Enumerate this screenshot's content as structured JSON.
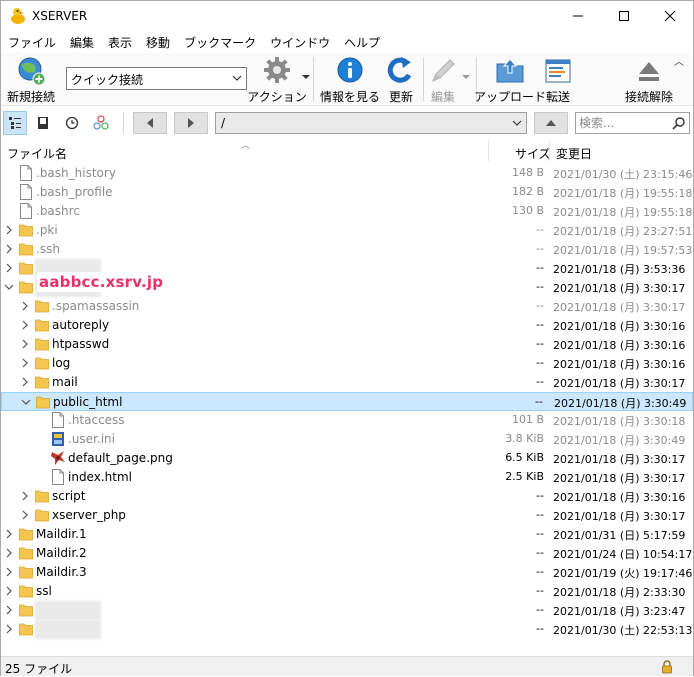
{
  "window": {
    "title": "XSERVER",
    "app_icon": "duck-icon",
    "controls": [
      "minimize-icon",
      "maximize-icon",
      "close-icon"
    ]
  },
  "menu": [
    "ファイル",
    "編集",
    "表示",
    "移動",
    "ブックマーク",
    "ウインドウ",
    "ヘルプ"
  ],
  "toolbar": {
    "new_connection": "新規接続",
    "quick_connect": "クイック接続",
    "action": "アクション",
    "info": "情報を見る",
    "refresh": "更新",
    "edit": "編集",
    "upload": "アップロード",
    "transfer": "転送",
    "disconnect": "接続解除"
  },
  "navbar": {
    "path": "/",
    "search_placeholder": "検索..."
  },
  "columns": {
    "name": "ファイル名",
    "size": "サイズ",
    "modified": "変更日"
  },
  "domain_label": "aabbcc.xsrv.jp",
  "files": [
    {
      "name": ".bash_history",
      "size": "148 B",
      "date": "2021/01/30 (土) 23:15:46",
      "type": "file",
      "depth": 0,
      "hidden": true
    },
    {
      "name": ".bash_profile",
      "size": "182 B",
      "date": "2021/01/18 (月) 19:55:18",
      "type": "file",
      "depth": 0,
      "hidden": true
    },
    {
      "name": ".bashrc",
      "size": "130 B",
      "date": "2021/01/18 (月) 19:55:18",
      "type": "file",
      "depth": 0,
      "hidden": true
    },
    {
      "name": ".pki",
      "size": "--",
      "date": "2021/01/18 (月) 23:27:51",
      "type": "folder",
      "depth": 0,
      "hidden": true,
      "expander": "collapsed"
    },
    {
      "name": ".ssh",
      "size": "--",
      "date": "2021/01/18 (月) 19:57:53",
      "type": "folder",
      "depth": 0,
      "hidden": true,
      "expander": "collapsed"
    },
    {
      "name": "",
      "size": "--",
      "date": "2021/01/18 (月) 3:53:36",
      "type": "folder",
      "depth": 0,
      "expander": "collapsed",
      "redacted": true
    },
    {
      "name": "",
      "size": "--",
      "date": "2021/01/18 (月) 3:30:17",
      "type": "folder",
      "depth": 0,
      "expander": "expanded",
      "redacted": true
    },
    {
      "name": ".spamassassin",
      "size": "--",
      "date": "2021/01/18 (月) 3:30:17",
      "type": "folder",
      "depth": 1,
      "hidden": true,
      "expander": "collapsed"
    },
    {
      "name": "autoreply",
      "size": "--",
      "date": "2021/01/18 (月) 3:30:16",
      "type": "folder",
      "depth": 1,
      "expander": "collapsed"
    },
    {
      "name": "htpasswd",
      "size": "--",
      "date": "2021/01/18 (月) 3:30:16",
      "type": "folder",
      "depth": 1,
      "expander": "collapsed"
    },
    {
      "name": "log",
      "size": "--",
      "date": "2021/01/18 (月) 3:30:16",
      "type": "folder",
      "depth": 1,
      "expander": "collapsed"
    },
    {
      "name": "mail",
      "size": "--",
      "date": "2021/01/18 (月) 3:30:17",
      "type": "folder",
      "depth": 1,
      "expander": "collapsed"
    },
    {
      "name": "public_html",
      "size": "--",
      "date": "2021/01/18 (月) 3:30:49",
      "type": "folder",
      "depth": 1,
      "expander": "expanded",
      "selected": true
    },
    {
      "name": ".htaccess",
      "size": "101 B",
      "date": "2021/01/18 (月) 3:30:18",
      "type": "file",
      "depth": 2,
      "hidden": true
    },
    {
      "name": ".user.ini",
      "size": "3.8 KiB",
      "date": "2021/01/18 (月) 3:30:49",
      "type": "ini",
      "depth": 2,
      "hidden": true
    },
    {
      "name": "default_page.png",
      "size": "6.5 KiB",
      "date": "2021/01/18 (月) 3:30:17",
      "type": "image",
      "depth": 2
    },
    {
      "name": "index.html",
      "size": "2.5 KiB",
      "date": "2021/01/18 (月) 3:30:17",
      "type": "file",
      "depth": 2
    },
    {
      "name": "script",
      "size": "--",
      "date": "2021/01/18 (月) 3:30:16",
      "type": "folder",
      "depth": 1,
      "expander": "collapsed"
    },
    {
      "name": "xserver_php",
      "size": "--",
      "date": "2021/01/18 (月) 3:30:17",
      "type": "folder",
      "depth": 1,
      "expander": "collapsed"
    },
    {
      "name": "Maildir.1",
      "size": "--",
      "date": "2021/01/31 (日) 5:17:59",
      "type": "folder",
      "depth": 0,
      "expander": "collapsed"
    },
    {
      "name": "Maildir.2",
      "size": "--",
      "date": "2021/01/24 (日) 10:54:17",
      "type": "folder",
      "depth": 0,
      "expander": "collapsed"
    },
    {
      "name": "Maildir.3",
      "size": "--",
      "date": "2021/01/19 (火) 19:17:46",
      "type": "folder",
      "depth": 0,
      "expander": "collapsed"
    },
    {
      "name": "ssl",
      "size": "--",
      "date": "2021/01/18 (月) 2:33:30",
      "type": "folder",
      "depth": 0,
      "expander": "collapsed"
    },
    {
      "name": "",
      "size": "--",
      "date": "2021/01/18 (月) 3:23:47",
      "type": "folder",
      "depth": 0,
      "expander": "collapsed",
      "redacted": true
    },
    {
      "name": "",
      "size": "--",
      "date": "2021/01/30 (土) 22:53:13",
      "type": "folder",
      "depth": 0,
      "expander": "collapsed",
      "redacted": true
    }
  ],
  "status": {
    "text": "25 ファイル",
    "lock_icon": "lock-icon"
  },
  "colors": {
    "selection": "#cce8ff",
    "domain_label": "#e8336a",
    "folder": "#f5c64e",
    "accent_blue": "#2f79c5"
  }
}
